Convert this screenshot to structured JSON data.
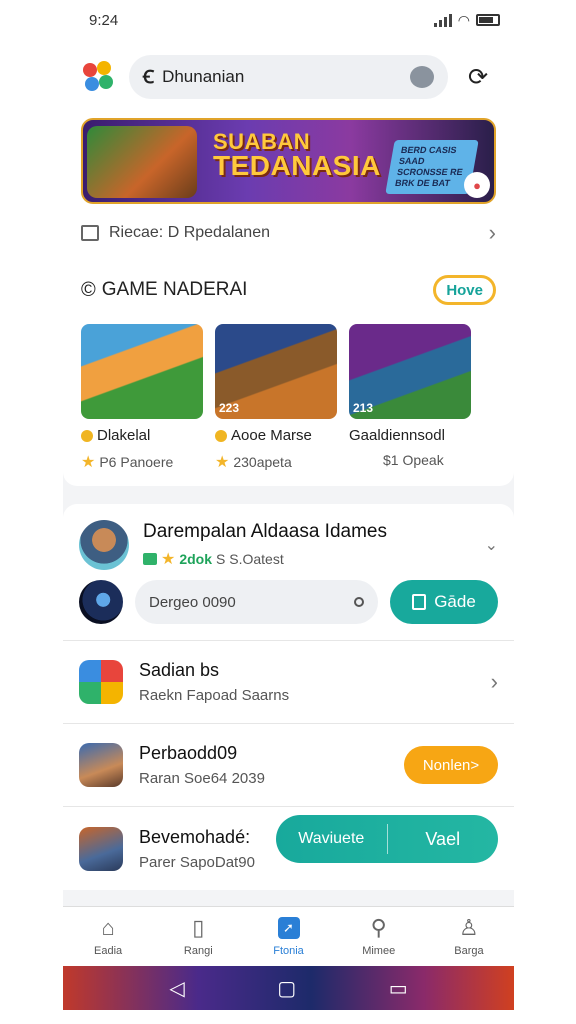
{
  "status": {
    "time": "9:24"
  },
  "search": {
    "value": "Dhunanian"
  },
  "banner": {
    "title_line1": "SUABAN",
    "title_line2": "TEDANASIA",
    "tag": "BERD CASIS SAAD SCRONSSE RE BRK DE BAT"
  },
  "info": {
    "label": "Riecae: D Rpedalanen"
  },
  "section": {
    "title": "GAME NADERAI",
    "more_label": "Hove"
  },
  "games": [
    {
      "name": "Dlakelal",
      "meta": "P6 Panoere",
      "num": ""
    },
    {
      "name": "Aooe Marse",
      "meta": "230apeta",
      "num": "223"
    },
    {
      "name": "Gaaldiennsodl",
      "meta": "$1 Opeak",
      "num": "213"
    }
  ],
  "profile": {
    "name": "Darempalan Aldaasa Idames",
    "points": "2dok",
    "sub": "S S.Oatest"
  },
  "input": {
    "value": "Dergeo 0090",
    "button_label": "Gāde"
  },
  "rows": [
    {
      "title": "Sadian bs",
      "sub": "Raekn Fapoad Saarns"
    },
    {
      "title": "Perbaodd09",
      "sub": "Raran Soe64 2039",
      "button": "Nonlen>"
    },
    {
      "title": "Bevemohadé:",
      "sub": "Parer SapoDat90",
      "btn_a": "Waviuete",
      "btn_b": "Vael"
    }
  ],
  "tabs": [
    {
      "label": "Eadia"
    },
    {
      "label": "Rangi"
    },
    {
      "label": "Ftonia"
    },
    {
      "label": "Mimee"
    },
    {
      "label": "Barga"
    }
  ]
}
